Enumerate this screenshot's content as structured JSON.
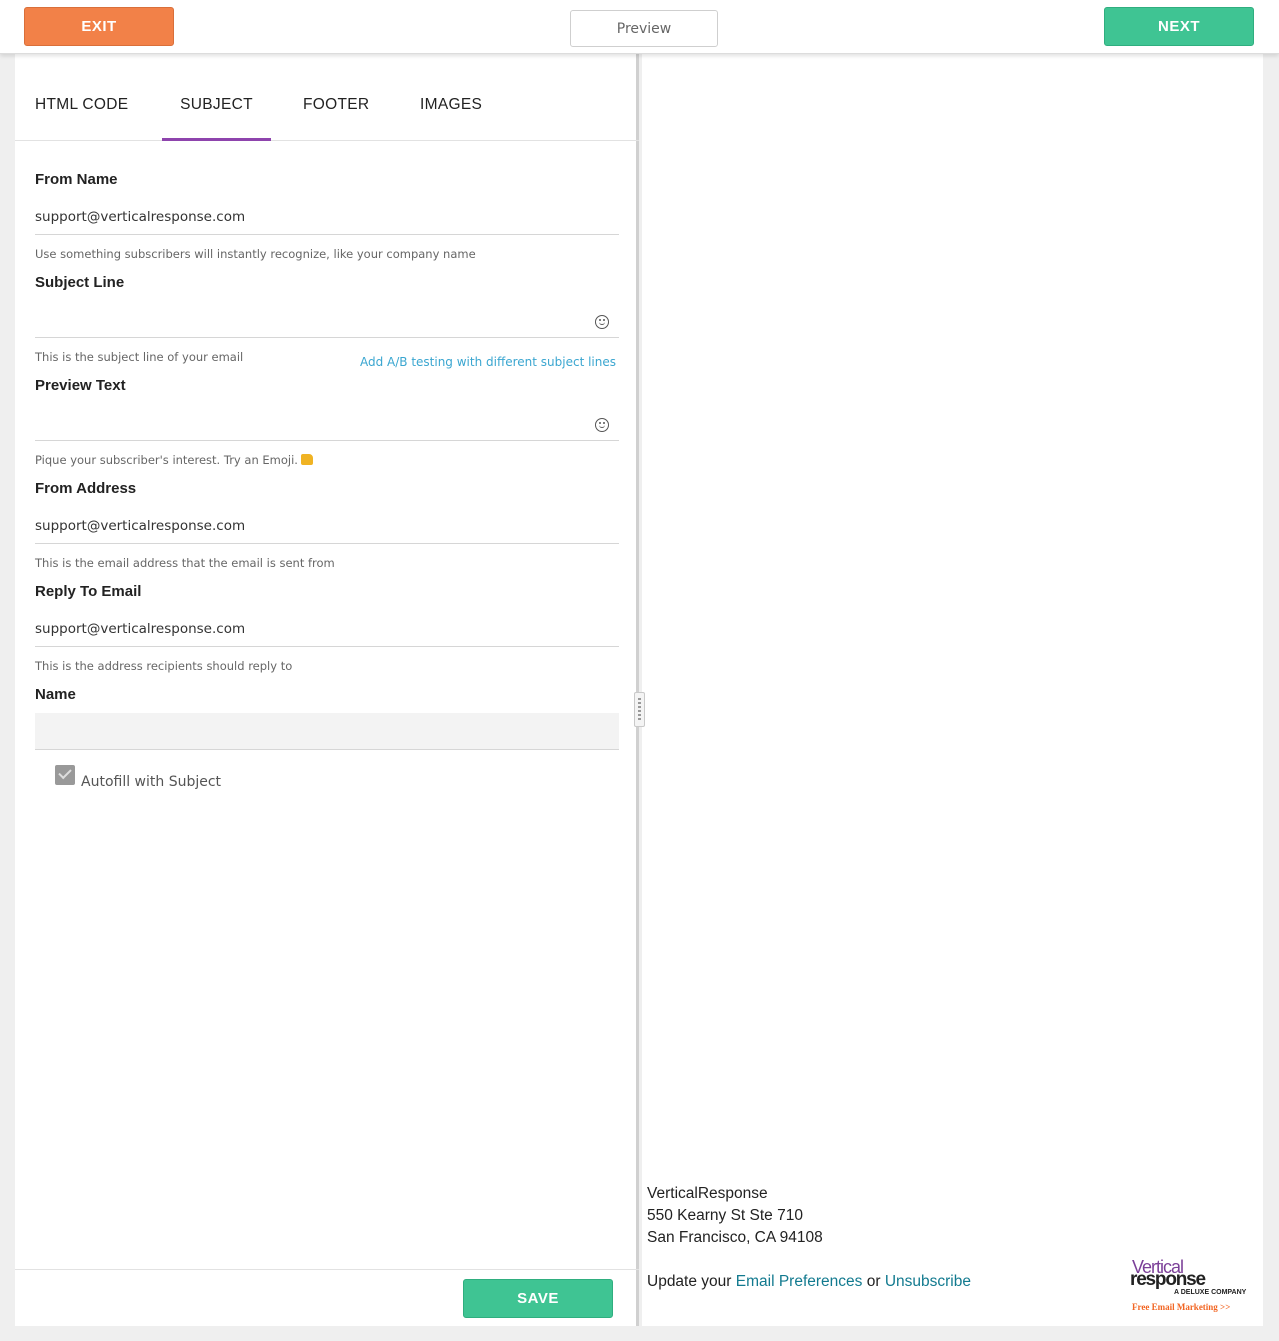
{
  "topbar": {
    "exit_label": "EXIT",
    "preview_label": "Preview",
    "next_label": "NEXT"
  },
  "tabs": [
    {
      "label": "HTML CODE",
      "active": false
    },
    {
      "label": "SUBJECT",
      "active": true
    },
    {
      "label": "FOOTER",
      "active": false
    },
    {
      "label": "IMAGES",
      "active": false
    }
  ],
  "form": {
    "from_name": {
      "label": "From Name",
      "value": "support@verticalresponse.com",
      "hint": "Use something subscribers will instantly recognize, like your company name"
    },
    "subject_line": {
      "label": "Subject Line",
      "value": "",
      "hint": "This is the subject line of your email",
      "ab_link": "Add A/B testing with different subject lines"
    },
    "preview_text": {
      "label": "Preview Text",
      "value": "",
      "hint": "Pique your subscriber's interest. Try an Emoji."
    },
    "from_address": {
      "label": "From Address",
      "value": "support@verticalresponse.com",
      "hint": "This is the email address that the email is sent from"
    },
    "reply_to": {
      "label": "Reply To Email",
      "value": "support@verticalresponse.com",
      "hint": "This is the address recipients should reply to"
    },
    "name": {
      "label": "Name",
      "value": ""
    },
    "autofill": {
      "label": "Autofill with Subject",
      "checked": true
    },
    "save_label": "SAVE"
  },
  "preview": {
    "address": [
      "VerticalResponse",
      "550 Kearny St Ste 710",
      "San Francisco, CA 94108"
    ],
    "update_prefix": "Update your",
    "preferences_link": "Email Preferences",
    "or_text": "or",
    "unsubscribe_link": "Unsubscribe",
    "logo": {
      "line1": "Vertical",
      "line2": "response",
      "tagline": "A DELUXE COMPANY",
      "free_text": "Free Email Marketing >>"
    }
  },
  "colors": {
    "exit": "#f28148",
    "next": "#3fc493",
    "tab_active": "#8e44ad",
    "link": "#127a8f",
    "ab_link": "#3aa6d0"
  }
}
